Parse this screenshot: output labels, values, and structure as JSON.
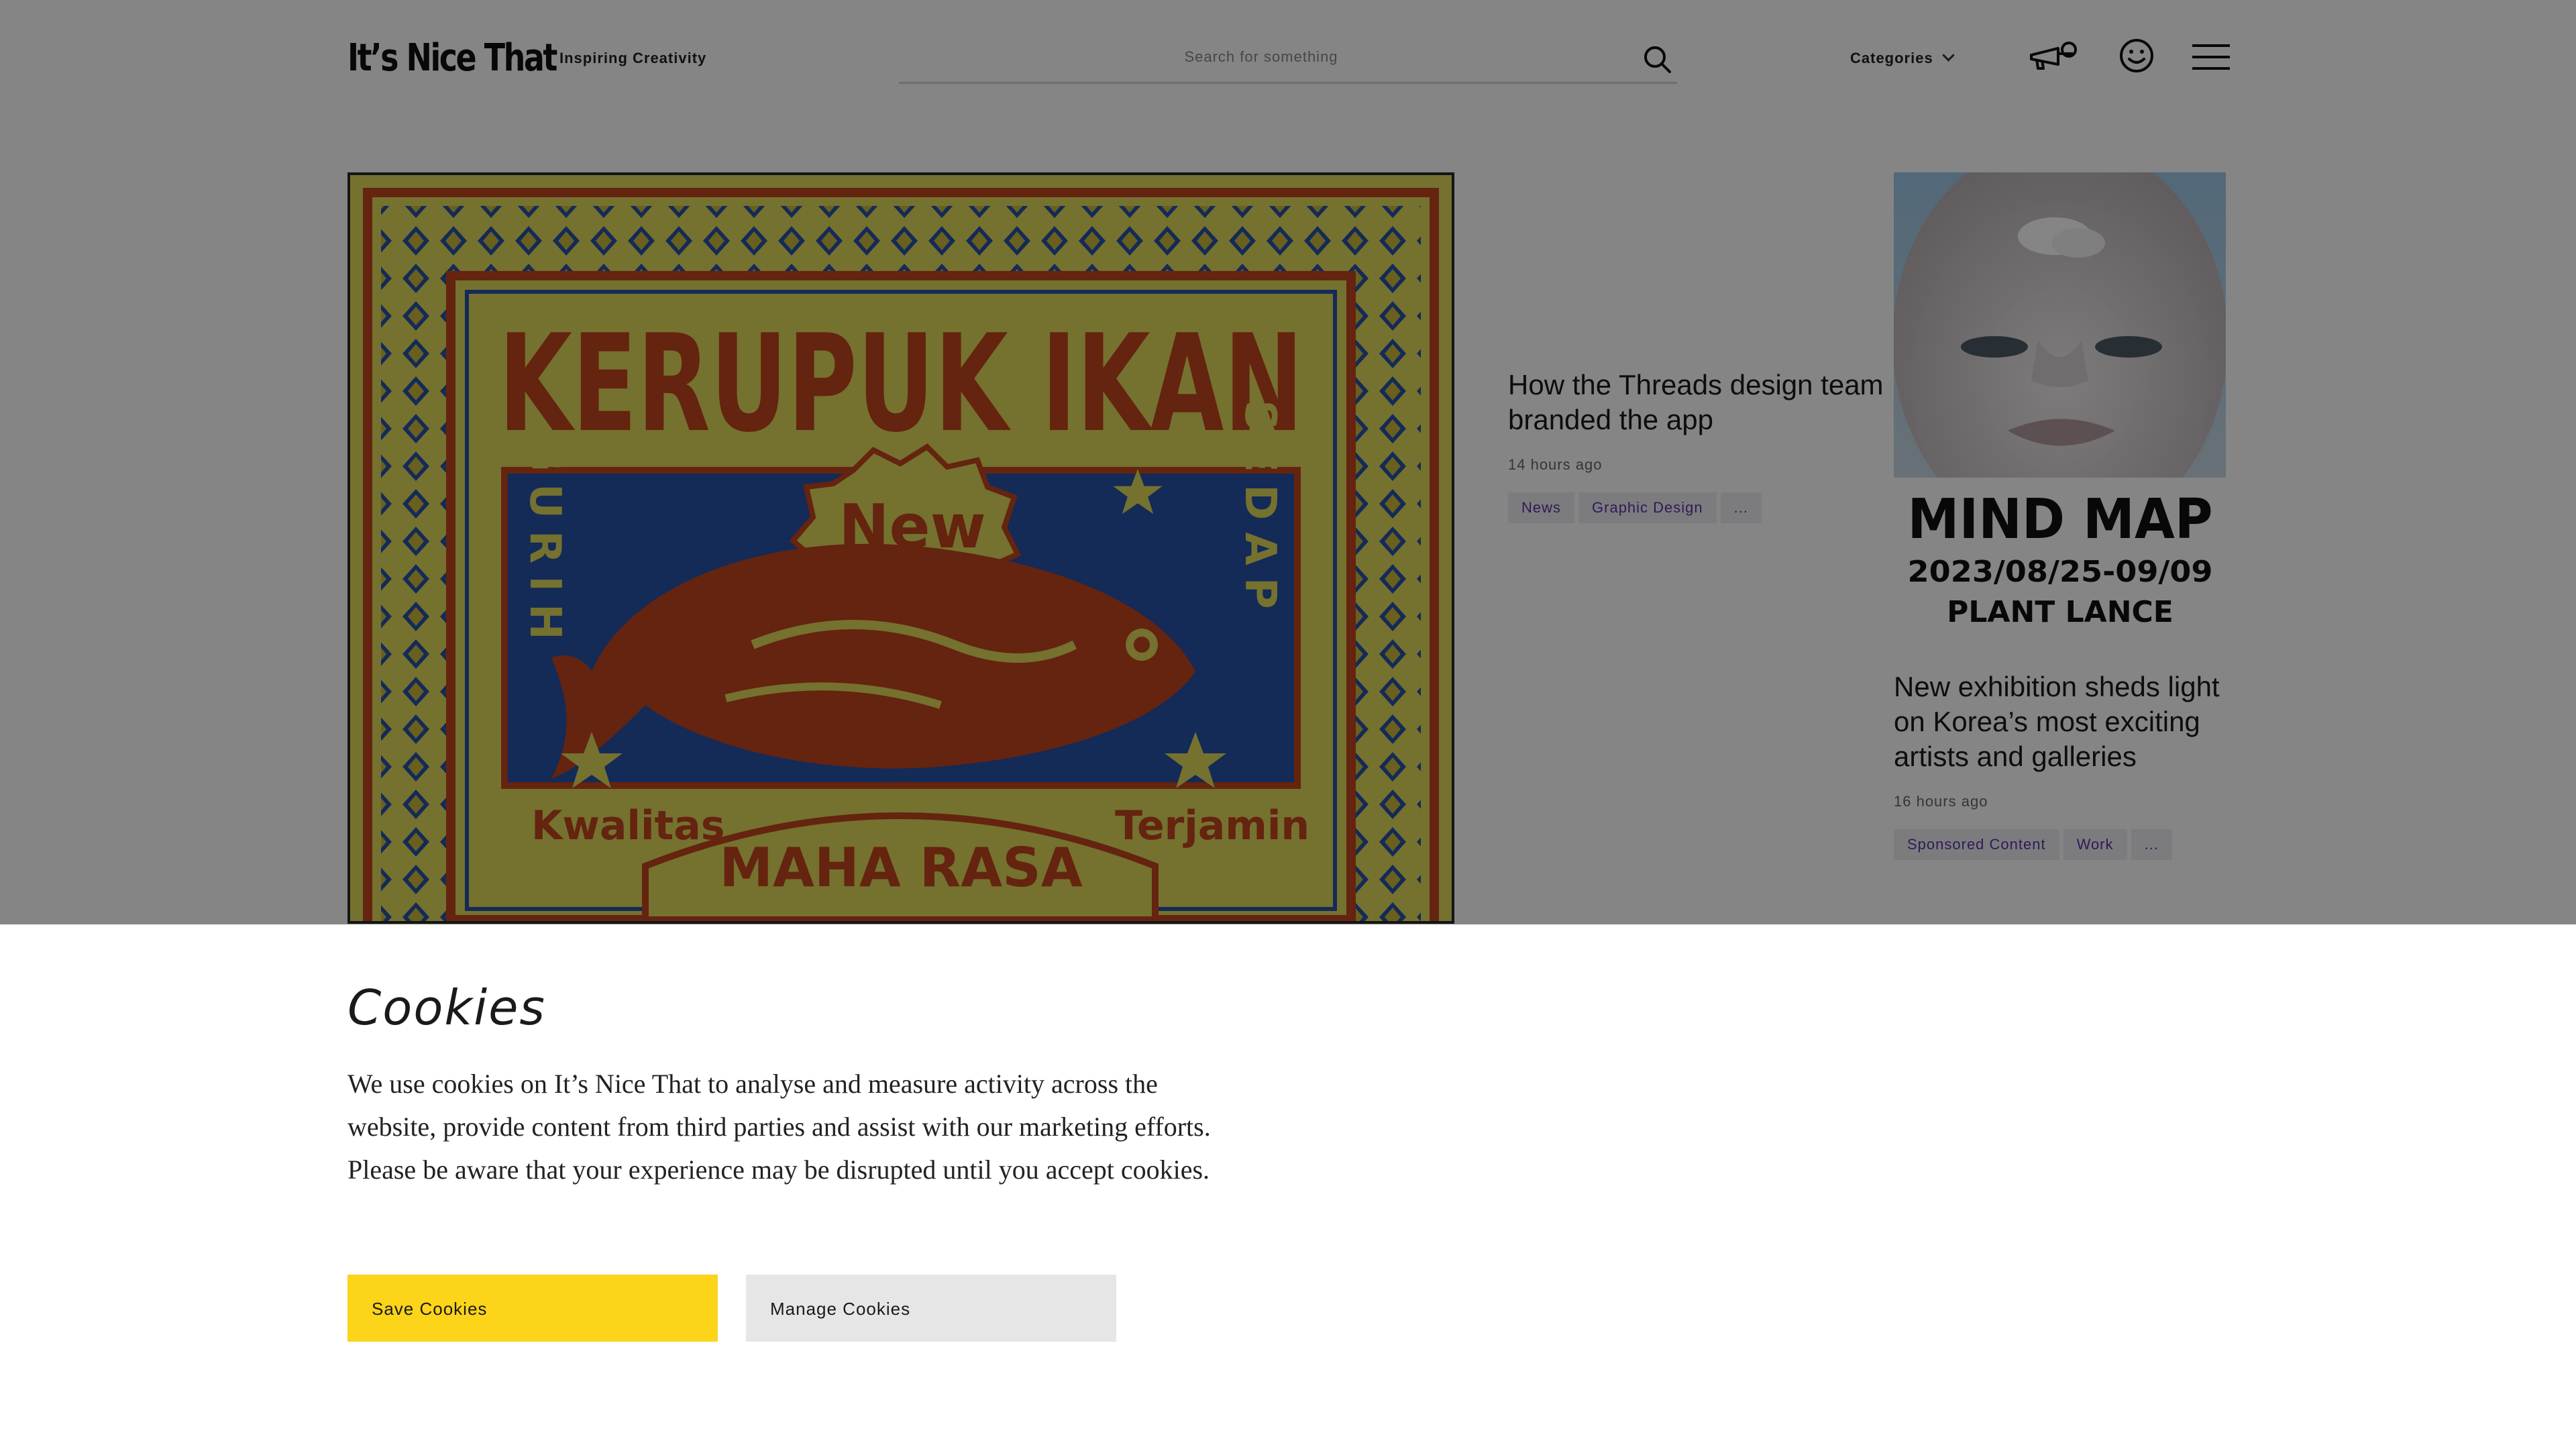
{
  "header": {
    "logo": "It’s Nice That",
    "tagline": "Inspiring Creativity",
    "search_placeholder": "Search for something",
    "categories_label": "Categories"
  },
  "hero": {
    "heading": "KERUPUK IKAN",
    "badge": "New",
    "left_vertical": "GURIH",
    "right_vertical": "SEDAP",
    "left_bottom": "Kwalitas",
    "right_bottom": "Terjamin",
    "banner": "MAHA RASA"
  },
  "articles": [
    {
      "title": "How the Threads design team branded the app",
      "time": "14 hours ago",
      "tags": [
        "News",
        "Graphic Design",
        "..."
      ]
    },
    {
      "title": "New exhibition sheds light on Korea’s most exciting artists and galleries",
      "time": "16 hours ago",
      "tags": [
        "Sponsored Content",
        "Work",
        "..."
      ]
    }
  ],
  "poster": {
    "title": "MIND MAP",
    "dates": "2023/08/25-09/09",
    "venue": "PLANT LANCE"
  },
  "cookie_banner": {
    "title": "Cookies",
    "text": "We use cookies on It’s Nice That to analyse and measure activity across the website, provide content from third parties and assist with our marketing efforts. Please be aware that your experience may be disrupted until you accept cookies.",
    "save_label": "Save Cookies",
    "manage_label": "Manage Cookies"
  },
  "colors": {
    "accent_yellow": "#fcd419",
    "tag_text": "#5b33a8",
    "tag_bg": "#eeeef3",
    "hero_yellow": "#e1d85a",
    "hero_blue": "#2752a8",
    "hero_red": "#c0451d"
  }
}
